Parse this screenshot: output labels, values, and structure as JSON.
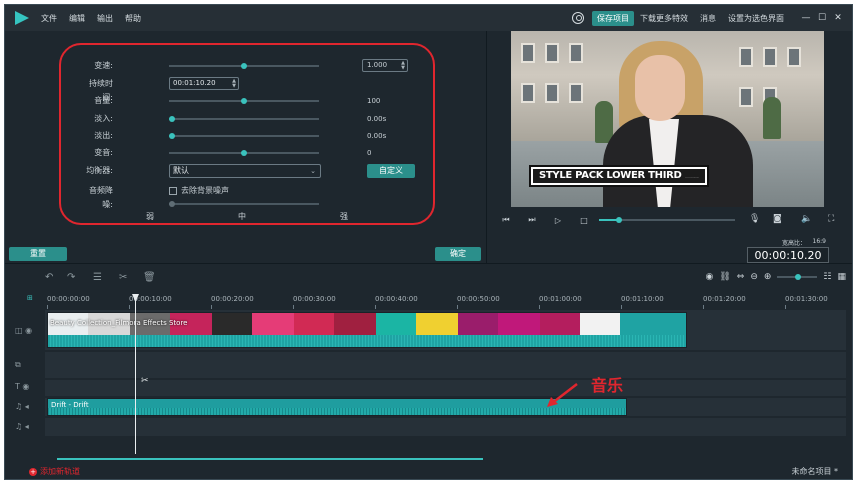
{
  "menu": [
    "文件",
    "编辑",
    "输出",
    "帮助"
  ],
  "titlebar": {
    "save_label": "保存项目",
    "download_label": "下载更多特效",
    "messages_label": "消息",
    "set_home_label": "设置为选色界面"
  },
  "audio_settings": {
    "speed_label": "变速:",
    "speed_value": "1.000",
    "duration_label": "持续时间:",
    "duration_value": "00:01:10.20",
    "volume_label": "音量:",
    "volume_value": "100",
    "fade_in_label": "淡入:",
    "fade_in_value": "0.00s",
    "fade_out_label": "淡出:",
    "fade_out_value": "0.00s",
    "pitch_label": "变音:",
    "pitch_value": "0",
    "equalizer_label": "均衡器:",
    "equalizer_value": "默认",
    "custom_label": "自定义",
    "denoise_label": "音频降噪:",
    "denoise_checkbox_label": "去除背景噪声",
    "level_low": "弱",
    "level_mid": "中",
    "level_high": "强",
    "speed_level": 0.5,
    "volume_level": 0.5,
    "fade_in_level": 0.0,
    "fade_out_level": 0.0,
    "pitch_level": 0.5
  },
  "buttons": {
    "reset_label": "重置",
    "ok_label": "确定"
  },
  "preview": {
    "lower_third_text": "STYLE PACK LOWER THIRD",
    "lower_third_sub": "...............",
    "ratio_label": "宽高比：",
    "ratio_value": "16:9",
    "timecode": "00:00:10.20",
    "progress": 0.15
  },
  "timeline": {
    "ruler_ticks": [
      "00:00:00:00",
      "00:00:10:00",
      "00:00:20:00",
      "00:00:30:00",
      "00:00:40:00",
      "00:00:50:00",
      "00:01:00:00",
      "00:01:10:00",
      "00:01:20:00",
      "00:01:30:00"
    ],
    "video_clip_name": "Beauty Collection_Filmora Effects Store",
    "audio_clip_name": "Drift - Drift",
    "annotation": "音乐",
    "add_track_label": "添加新轨道",
    "project_name": "未命名项目 *"
  },
  "colors": {
    "accent": "#2b8f8b",
    "highlight": "#e0262e",
    "background": "#1e272e"
  }
}
